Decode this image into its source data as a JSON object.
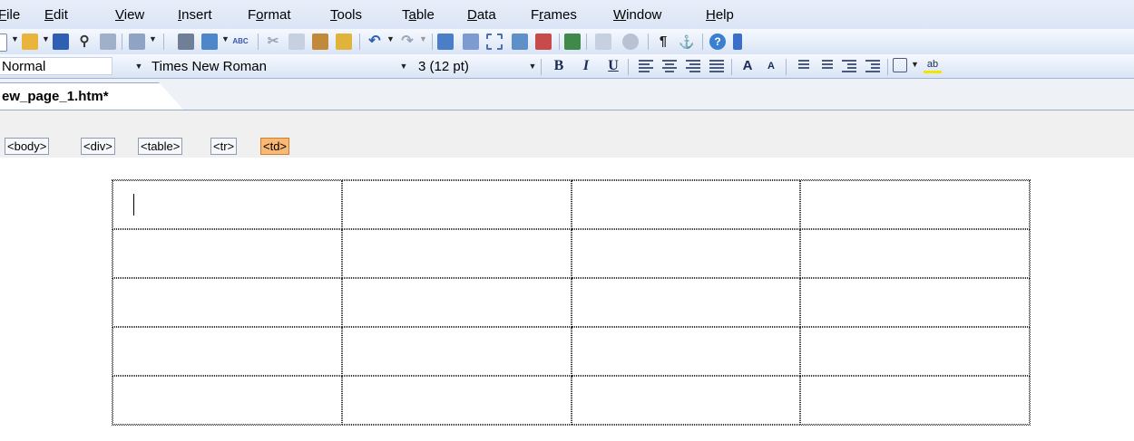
{
  "menu": [
    {
      "id": "file",
      "pre": "",
      "ul": "F",
      "post": "ile"
    },
    {
      "id": "edit",
      "pre": "",
      "ul": "E",
      "post": "dit"
    },
    {
      "id": "view",
      "pre": "",
      "ul": "V",
      "post": "iew"
    },
    {
      "id": "insert",
      "pre": "",
      "ul": "I",
      "post": "nsert"
    },
    {
      "id": "format",
      "pre": "F",
      "ul": "o",
      "post": "rmat"
    },
    {
      "id": "tools",
      "pre": "",
      "ul": "T",
      "post": "ools"
    },
    {
      "id": "table",
      "pre": "T",
      "ul": "a",
      "post": "ble"
    },
    {
      "id": "data",
      "pre": "",
      "ul": "D",
      "post": "ata"
    },
    {
      "id": "frames",
      "pre": "F",
      "ul": "r",
      "post": "ames"
    },
    {
      "id": "window",
      "pre": "",
      "ul": "W",
      "post": "indow"
    },
    {
      "id": "help",
      "pre": "",
      "ul": "H",
      "post": "elp"
    }
  ],
  "formatting": {
    "style": "Normal",
    "font": "Times New Roman",
    "size": "3 (12 pt)",
    "bold_glyph": "B",
    "italic_glyph": "I",
    "underline_glyph": "U",
    "grow_font_glyph": "A",
    "shrink_font_glyph": "A",
    "highlight_glyph": "ab"
  },
  "toolbar_glyphs": {
    "spelling": "ABC",
    "paragraph": "¶",
    "anchor": "⚓"
  },
  "document_tab": "ew_page_1.htm*",
  "quick_tags": [
    "<body>",
    "<div>",
    "<table>",
    "<tr>",
    "<td>"
  ],
  "active_tag": "<td>",
  "table": {
    "rows": 5,
    "columns": 4
  },
  "colors": {
    "menubar": "#dbe5f6",
    "active_tag": "#f9b873",
    "toolbar": "#d9e4f5"
  }
}
